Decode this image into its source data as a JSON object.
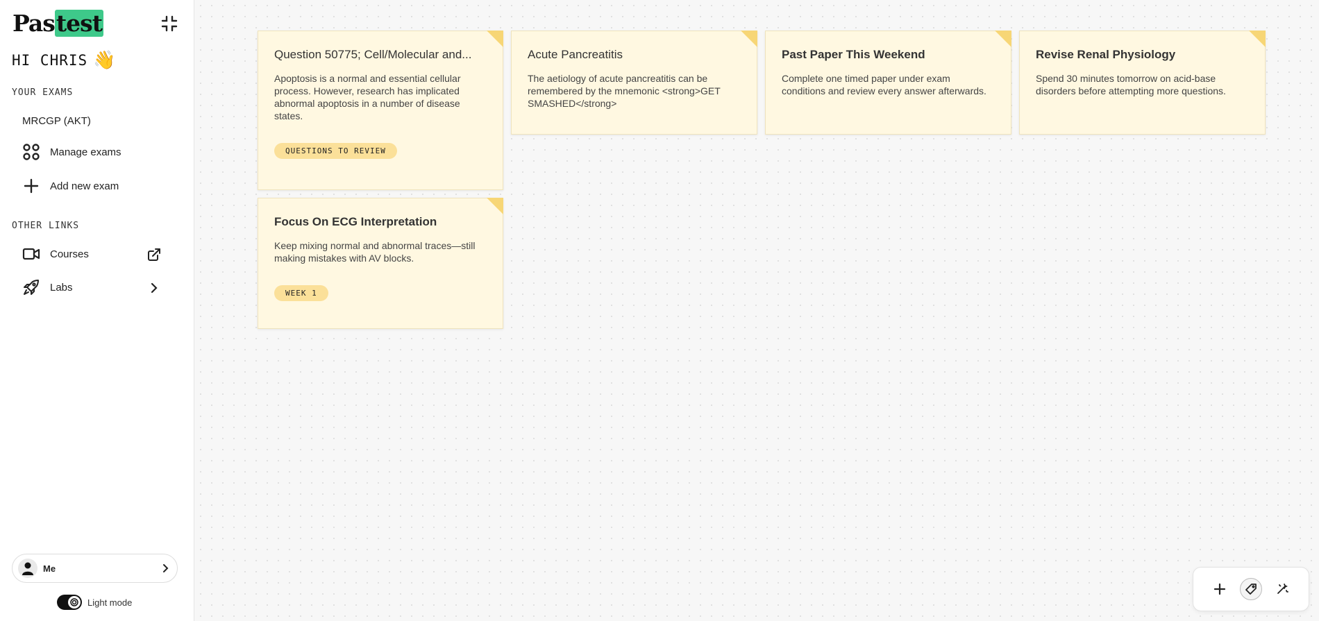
{
  "sidebar": {
    "logo": {
      "main": "Pas",
      "highlight": "test"
    },
    "greeting": "HI CHRIS",
    "greeting_emoji": "👋",
    "your_exams_label": "YOUR EXAMS",
    "exams": [
      {
        "label": "MRCGP (AKT)"
      }
    ],
    "manage_exams": {
      "label": "Manage exams",
      "icon": "apps-icon"
    },
    "add_exam": {
      "label": "Add new exam",
      "icon": "plus-icon"
    },
    "other_links_label": "OTHER LINKS",
    "courses": {
      "label": "Courses",
      "icon": "video-camera-icon"
    },
    "labs": {
      "label": "Labs",
      "icon": "rocket-icon"
    },
    "user": {
      "name": "Me"
    },
    "theme": {
      "label": "Light mode"
    }
  },
  "notes": [
    {
      "title": "Question 50775; Cell/Molecular and...",
      "body": "Apoptosis is a normal and essential cellular process. However, research has implicated abnormal apoptosis in a number of disease states.",
      "tag": "QUESTIONS TO REVIEW"
    },
    {
      "title": "Acute Pancreatitis",
      "body": "The aetiology of acute pancreatitis can be remembered by the mnemonic <strong>GET SMASHED</strong>"
    },
    {
      "title": "Past Paper This Weekend",
      "body": "Complete one timed paper under exam conditions and review every answer afterwards."
    },
    {
      "title": "Revise Renal Physiology",
      "body": "Spend 30 minutes tomorrow on acid-base disorders before attempting more questions."
    },
    {
      "title": "Focus On ECG Interpretation",
      "body": "Keep mixing normal and abnormal traces—still making mistakes with AV blocks.",
      "tag": "WEEK 1"
    }
  ],
  "colors": {
    "note_bg": "#fff8e1",
    "note_fold": "#f7d676",
    "tag_bg": "#fbe099",
    "logo_highlight": "#3ec98a"
  },
  "toolbar": {
    "add": "plus-icon",
    "tags": "tag-icon",
    "magic": "magic-wand-icon"
  }
}
